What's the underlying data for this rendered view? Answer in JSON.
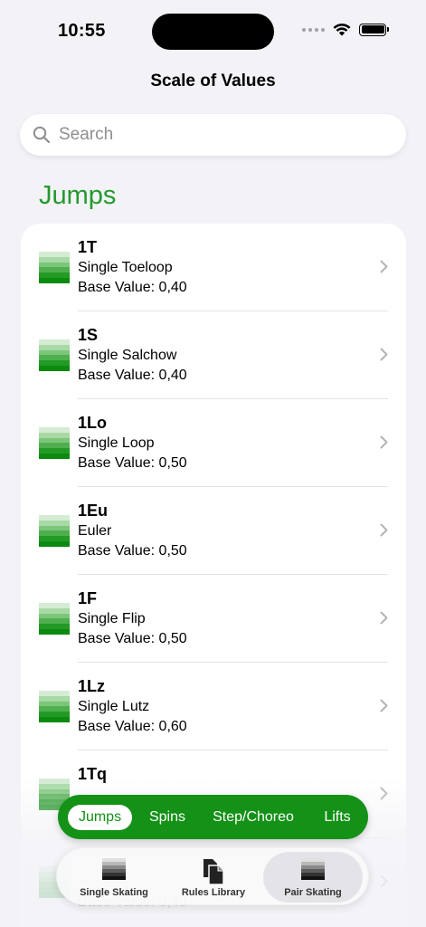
{
  "status_bar": {
    "time": "10:55"
  },
  "nav": {
    "title": "Scale of Values"
  },
  "search": {
    "placeholder": "Search"
  },
  "section": {
    "title": "Jumps"
  },
  "icon_colors": [
    "#d4ecd3",
    "#a8d9a6",
    "#7cc67a",
    "#4faf4e",
    "#239a26",
    "#0b8a10"
  ],
  "elements": [
    {
      "code": "1T",
      "name": "Single Toeloop",
      "base": "Base Value: 0,40"
    },
    {
      "code": "1S",
      "name": "Single Salchow",
      "base": "Base Value: 0,40"
    },
    {
      "code": "1Lo",
      "name": "Single Loop",
      "base": "Base Value: 0,50"
    },
    {
      "code": "1Eu",
      "name": "Euler",
      "base": "Base Value: 0,50"
    },
    {
      "code": "1F",
      "name": "Single Flip",
      "base": "Base Value: 0,50"
    },
    {
      "code": "1Lz",
      "name": "Single Lutz",
      "base": "Base Value: 0,60"
    },
    {
      "code": "1Tq",
      "name": "",
      "base": ""
    },
    {
      "code": "",
      "name": "",
      "base": "Base Value: 0,40"
    }
  ],
  "categories": {
    "jumps": "Jumps",
    "spins": "Spins",
    "step": "Step/Choreo",
    "lifts": "Lifts",
    "active": "jumps"
  },
  "tabs": {
    "single": {
      "label": "Single Skating",
      "icon": "skate-gradient-icon"
    },
    "rules": {
      "label": "Rules Library",
      "icon": "documents-icon"
    },
    "pair": {
      "label": "Pair Skating",
      "icon": "skate-gradient-icon"
    },
    "active": "pair"
  }
}
